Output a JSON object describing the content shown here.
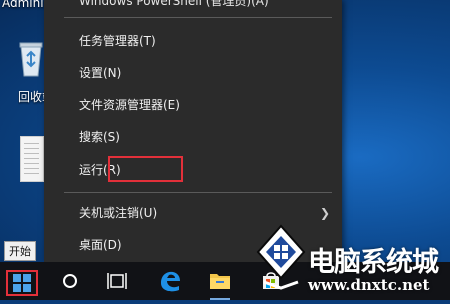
{
  "desktop": {
    "top_partial_text": "Adminis",
    "recycle_bin_label": "回收站",
    "start_tooltip": "开始"
  },
  "context_menu": {
    "partial_top_item": "Windows PowerShell (管理员)(A)",
    "items": [
      {
        "label": "任务管理器(T)"
      },
      {
        "label": "设置(N)"
      },
      {
        "label": "文件资源管理器(E)"
      },
      {
        "label": "搜索(S)"
      },
      {
        "label": "运行(R)",
        "highlighted": true
      },
      {
        "label": "关机或注销(U)",
        "submenu_icon": "chevron-right-icon"
      },
      {
        "label": "桌面(D)"
      }
    ],
    "highlight_color": "#e3303a",
    "background_color": "#2b2b2b"
  },
  "taskbar": {
    "buttons": [
      {
        "name": "start-button",
        "icon": "windows-logo-icon"
      },
      {
        "name": "search-button",
        "icon": "circle-search-icon"
      },
      {
        "name": "task-view-button",
        "icon": "task-view-icon"
      },
      {
        "name": "edge-button",
        "icon": "edge-icon"
      },
      {
        "name": "file-explorer-button",
        "icon": "folder-icon"
      },
      {
        "name": "store-button",
        "icon": "store-bag-icon"
      }
    ]
  },
  "watermark": {
    "title": "电脑系统城",
    "url": "www.dnxtc.net"
  }
}
